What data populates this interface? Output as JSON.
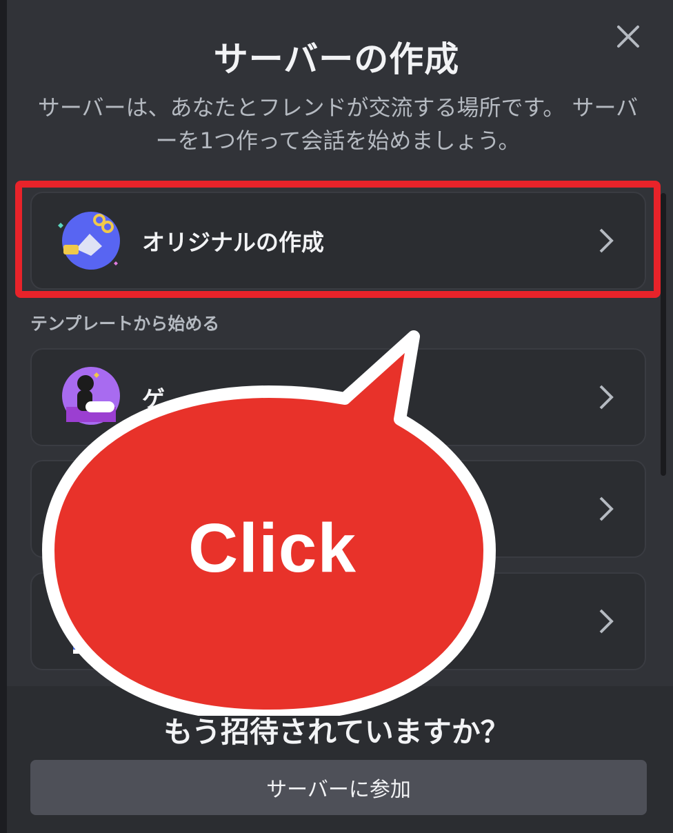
{
  "modal": {
    "title": "サーバーの作成",
    "subtitle": "サーバーは、あなたとフレンドが交流する場所です。 サーバーを1つ作って会話を始めましょう。",
    "close_icon": "close-icon"
  },
  "options": {
    "create_own": {
      "label": "オリジナルの作成",
      "icon": "create-own-icon"
    },
    "template_section_label": "テンプレートから始める",
    "templates": [
      {
        "label": "ゲ",
        "icon": "gaming-icon"
      },
      {
        "label": "",
        "icon": "template-icon"
      },
      {
        "label": "",
        "icon": "template-icon"
      }
    ]
  },
  "footer": {
    "title": "もう招待されていますか？",
    "join_label": "サーバーに参加"
  },
  "annotation": {
    "callout_text": "Click",
    "highlight_color": "#e8232a"
  },
  "colors": {
    "background": "#313338",
    "card": "#2b2d31",
    "button": "#4e5058",
    "callout": "#e8322a"
  }
}
